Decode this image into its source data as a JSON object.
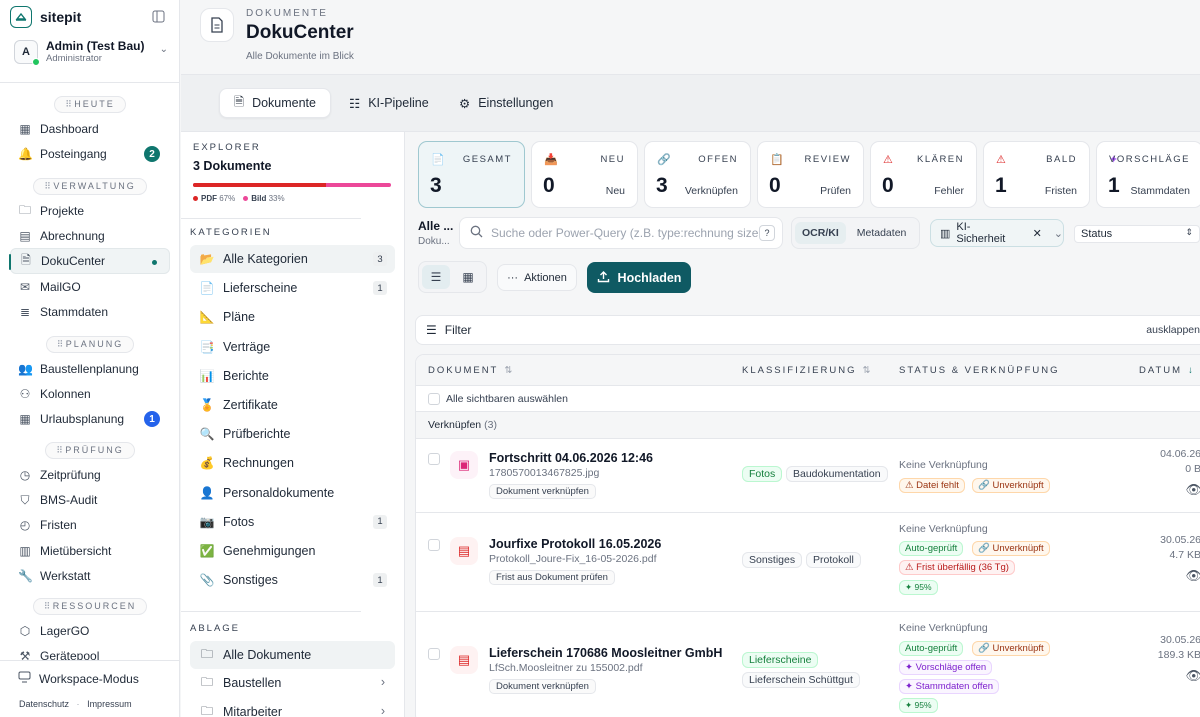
{
  "app": {
    "name": "sitepit"
  },
  "user": {
    "initial": "A",
    "name": "Admin (Test Bau)",
    "role": "Administrator"
  },
  "sidebar": {
    "sections": [
      {
        "label": "HEUTE",
        "items": [
          {
            "label": "Dashboard",
            "icon": "grid-icon"
          },
          {
            "label": "Posteingang",
            "icon": "bell-icon",
            "badge": "2"
          }
        ]
      },
      {
        "label": "VERWALTUNG",
        "items": [
          {
            "label": "Projekte",
            "icon": "folder-icon"
          },
          {
            "label": "Abrechnung",
            "icon": "calculator-icon"
          },
          {
            "label": "DokuCenter",
            "icon": "document-icon",
            "active": true
          },
          {
            "label": "MailGO",
            "icon": "mail-icon"
          },
          {
            "label": "Stammdaten",
            "icon": "database-icon"
          }
        ]
      },
      {
        "label": "PLANUNG",
        "items": [
          {
            "label": "Baustellenplanung",
            "icon": "users-icon"
          },
          {
            "label": "Kolonnen",
            "icon": "team-icon"
          },
          {
            "label": "Urlaubsplanung",
            "icon": "calendar-icon",
            "badge": "1"
          }
        ]
      },
      {
        "label": "PRÜFUNG",
        "items": [
          {
            "label": "Zeitprüfung",
            "icon": "clock-icon"
          },
          {
            "label": "BMS-Audit",
            "icon": "shield-icon"
          },
          {
            "label": "Fristen",
            "icon": "timer-icon"
          },
          {
            "label": "Mietübersicht",
            "icon": "chart-icon"
          },
          {
            "label": "Werkstatt",
            "icon": "wrench-icon"
          }
        ]
      },
      {
        "label": "RESSOURCEN",
        "items": [
          {
            "label": "LagerGO",
            "icon": "box-icon"
          },
          {
            "label": "Gerätepool",
            "icon": "tool-icon"
          }
        ]
      }
    ],
    "workspace": "Workspace-Modus",
    "legal": {
      "privacy": "Datenschutz",
      "imprint": "Impressum"
    }
  },
  "header": {
    "eyebrow": "DOKUMENTE",
    "title": "DokuCenter",
    "subtitle": "Alle Dokumente im Blick"
  },
  "tabs": [
    {
      "label": "Dokumente",
      "active": true
    },
    {
      "label": "KI-Pipeline"
    },
    {
      "label": "Einstellungen"
    }
  ],
  "explorer": {
    "label": "EXPLORER",
    "count": "3 Dokumente",
    "pdf_share": 0.67,
    "legend": [
      {
        "name": "PDF",
        "pct": "67%",
        "color": "#dc2626"
      },
      {
        "name": "Bild",
        "pct": "33%",
        "color": "#ec4899"
      }
    ],
    "categories_label": "KATEGORIEN",
    "categories": [
      {
        "label": "Alle Kategorien",
        "icon": "📂",
        "count": "3",
        "active": true
      },
      {
        "label": "Lieferscheine",
        "icon": "📄",
        "count": "1"
      },
      {
        "label": "Pläne",
        "icon": "📐"
      },
      {
        "label": "Verträge",
        "icon": "📑"
      },
      {
        "label": "Berichte",
        "icon": "📊"
      },
      {
        "label": "Zertifikate",
        "icon": "🏅"
      },
      {
        "label": "Prüfberichte",
        "icon": "🔍"
      },
      {
        "label": "Rechnungen",
        "icon": "💰"
      },
      {
        "label": "Personaldokumente",
        "icon": "👤"
      },
      {
        "label": "Fotos",
        "icon": "📷",
        "count": "1"
      },
      {
        "label": "Genehmigungen",
        "icon": "✅"
      },
      {
        "label": "Sonstiges",
        "icon": "📎",
        "count": "1"
      }
    ],
    "ablage_label": "ABLAGE",
    "ablage": [
      {
        "label": "Alle Dokumente",
        "active": true
      },
      {
        "label": "Baustellen"
      },
      {
        "label": "Mitarbeiter"
      }
    ]
  },
  "kpis": [
    {
      "label": "GESAMT",
      "value": "3",
      "sub": "",
      "icon": "📄",
      "active": true
    },
    {
      "label": "NEU",
      "value": "0",
      "sub": "Neu",
      "icon": "📥"
    },
    {
      "label": "OFFEN",
      "value": "3",
      "sub": "Verknüpfen",
      "icon": "🔗"
    },
    {
      "label": "REVIEW",
      "value": "0",
      "sub": "Prüfen",
      "icon": "📋"
    },
    {
      "label": "KLÄREN",
      "value": "0",
      "sub": "Fehler",
      "icon": "⚠"
    },
    {
      "label": "BALD",
      "value": "1",
      "sub": "Fristen",
      "icon": "⚠"
    },
    {
      "label": "VORSCHLÄGE",
      "value": "1",
      "sub": "Stammdaten",
      "icon": "✦"
    }
  ],
  "toolbar": {
    "scope_title": "Alle ...",
    "scope_sub": "Doku...",
    "search_placeholder": "Suche oder Power-Query (z.B. type:rechnung size",
    "search_help": "?",
    "segment": [
      "OCR/KI",
      "Metadaten"
    ],
    "ki_filter": "KI-Sicherheit",
    "status": "Status",
    "actions": "Aktionen",
    "upload": "Hochladen"
  },
  "filter": {
    "label": "Filter",
    "toggle": "ausklappen"
  },
  "table": {
    "columns": [
      "DOKUMENT",
      "KLASSIFIZIERUNG",
      "STATUS & VERKNÜPFUNG",
      "DATUM"
    ],
    "select_all": "Alle sichtbaren auswählen",
    "group": {
      "label": "Verknüpfen",
      "count": "(3)"
    },
    "rows": [
      {
        "title": "Fortschritt 04.06.2026 12:46",
        "file": "1780570013467825.jpg",
        "action": "Dokument verknüpfen",
        "icon": "image-icon",
        "tags": [
          "Fotos",
          "Baudokumentation"
        ],
        "status": "Keine Verknüpfung",
        "chips": [
          "Datei fehlt",
          "Unverknüpft"
        ],
        "date": "04.06.26",
        "size": "0 B"
      },
      {
        "title": "Jourfixe Protokoll 16.05.2026",
        "file": "Protokoll_Joure-Fix_16-05-2026.pdf",
        "action": "Frist aus Dokument prüfen",
        "icon": "pdf-icon",
        "tags": [
          "Sonstiges",
          "Protokoll"
        ],
        "status": "Keine Verknüpfung",
        "chips": [
          "Auto-geprüft",
          "Unverknüpft",
          "Frist überfällig (36 Tg)",
          "95%"
        ],
        "date": "30.05.26",
        "size": "4.7 KB"
      },
      {
        "title": "Lieferschein 170686 Moosleitner GmbH",
        "file": "LfSch.Moosleitner zu 155002.pdf",
        "action": "Dokument verknüpfen",
        "icon": "pdf-icon",
        "tags": [
          "Lieferscheine",
          "Lieferschein Schüttgut"
        ],
        "status": "Keine Verknüpfung",
        "chips": [
          "Auto-geprüft",
          "Unverknüpft",
          "Vorschläge offen",
          "Stammdaten offen",
          "95%"
        ],
        "date": "30.05.26",
        "size": "189.3 KB"
      }
    ]
  }
}
